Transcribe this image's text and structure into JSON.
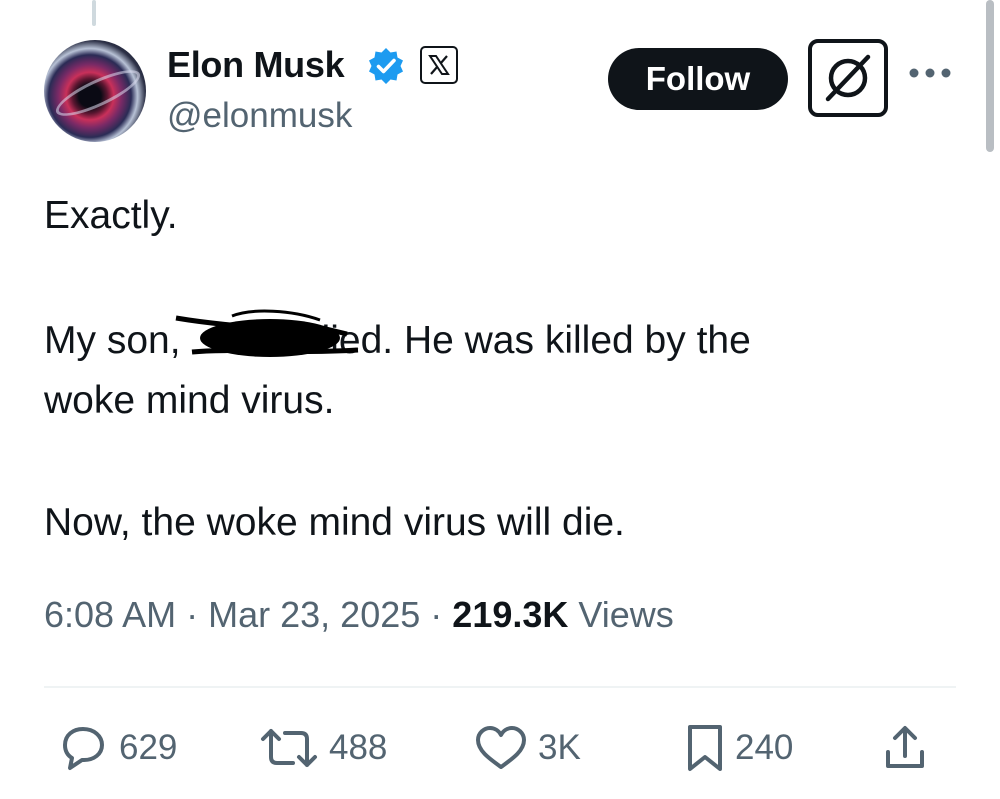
{
  "author": {
    "name": "Elon Musk",
    "handle": "@elonmusk"
  },
  "header": {
    "follow_label": "Follow"
  },
  "tweet": {
    "line_1": "Exactly.",
    "line_2_before": "My son,",
    "line_2_after": "died. He was killed by the",
    "line_3": "woke mind virus.",
    "line_4": "Now, the woke mind virus will die."
  },
  "meta": {
    "time": "6:08 AM",
    "separator": "·",
    "date": "Mar 23, 2025",
    "views_count": "219.3K",
    "views_label": "Views"
  },
  "actions": {
    "replies": "629",
    "reposts": "488",
    "likes": "3K",
    "bookmarks": "240"
  },
  "colors": {
    "text_primary": "#0f1419",
    "text_secondary": "#536471",
    "verified_blue": "#1d9bf0",
    "follow_bg": "#0f1419"
  },
  "icons": [
    "verified-badge-icon",
    "x-logo-icon",
    "grok-icon",
    "more-icon",
    "reply-icon",
    "repost-icon",
    "like-icon",
    "bookmark-icon",
    "share-icon"
  ]
}
